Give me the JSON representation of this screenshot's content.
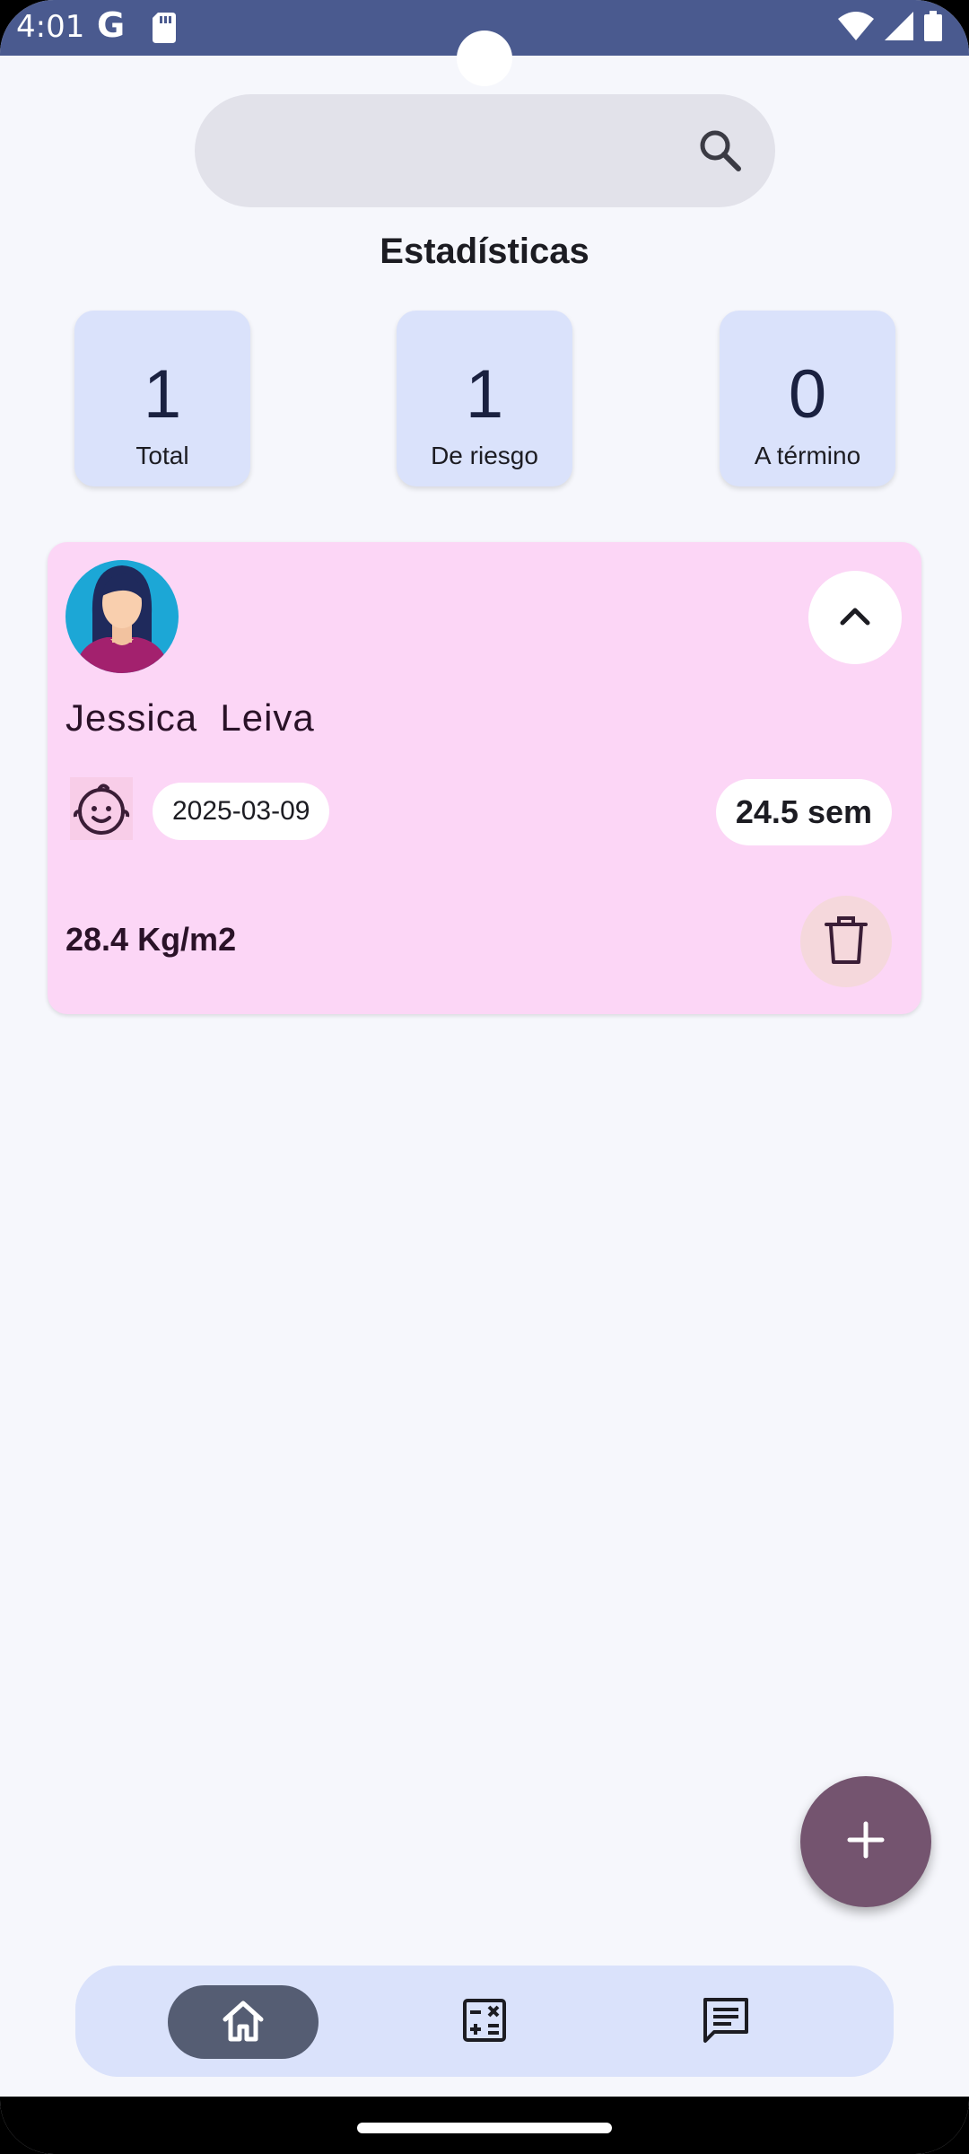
{
  "status_bar": {
    "time": "4:01",
    "g_label": "G"
  },
  "search": {
    "placeholder": ""
  },
  "section_title": "Estadísticas",
  "stats": [
    {
      "value": "1",
      "label": "Total"
    },
    {
      "value": "1",
      "label": "De riesgo"
    },
    {
      "value": "0",
      "label": "A término"
    }
  ],
  "patient": {
    "name": "Jessica  Leiva",
    "due_date": "2025-03-09",
    "weeks": "24.5 sem",
    "bmi": "28.4 Kg/m2"
  },
  "icons": {
    "search": "search-icon",
    "collapse": "chevron-up-icon",
    "baby": "baby-face-icon",
    "delete": "trash-icon",
    "fab": "plus-icon",
    "nav_home": "home-icon",
    "nav_calculator": "calculator-icon",
    "nav_chat": "chat-icon"
  },
  "colors": {
    "status_bar": "#4a5a8f",
    "stat_card": "#dae2fb",
    "patient_card": "#fcd6f6",
    "fab": "#74546f",
    "nav_active": "#555d73"
  }
}
